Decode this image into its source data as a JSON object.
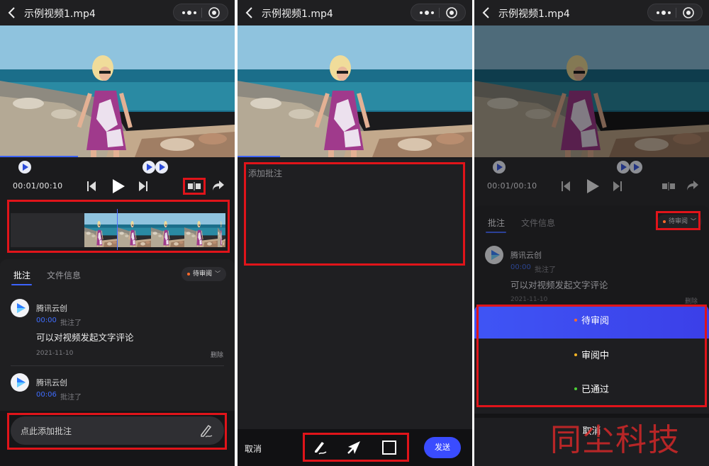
{
  "screens": [
    {
      "title": "示例视频1.mp4",
      "time_current": "00:01",
      "time_sep": "/",
      "time_total": "00:10",
      "tabs": [
        "批注",
        "文件信息"
      ],
      "status": "待审阅",
      "comments": [
        {
          "author": "腾讯云创",
          "timestamp": "00:00",
          "action": "批注了",
          "text": "可以对视频发起文字评论",
          "date": "2021-11-10",
          "delete": "删除"
        },
        {
          "author": "腾讯云创",
          "timestamp": "00:06",
          "action": "批注了"
        }
      ],
      "input_placeholder": "点此添加批注"
    },
    {
      "title": "示例视频1.mp4",
      "annotation_placeholder": "添加批注",
      "cancel": "取消",
      "send": "发送"
    },
    {
      "title": "示例视频1.mp4",
      "time_current": "00:01",
      "time_sep": "/",
      "time_total": "00:10",
      "tabs": [
        "批注",
        "文件信息"
      ],
      "status": "待审阅",
      "comment": {
        "author": "腾讯云创",
        "timestamp": "00:00",
        "action": "批注了",
        "text": "可以对视频发起文字评论",
        "date": "2021-11-10",
        "delete": "删除"
      },
      "options": [
        {
          "label": "待审阅",
          "dot": "#ff6a2b",
          "selected": true
        },
        {
          "label": "审阅中",
          "dot": "#f5b324",
          "selected": false
        },
        {
          "label": "已通过",
          "dot": "#4cd137",
          "selected": false
        }
      ],
      "cancel": "取消"
    }
  ],
  "watermark": "同尘科技",
  "colors": {
    "accent": "#3a4cff",
    "highlight_box": "#e0141a"
  }
}
